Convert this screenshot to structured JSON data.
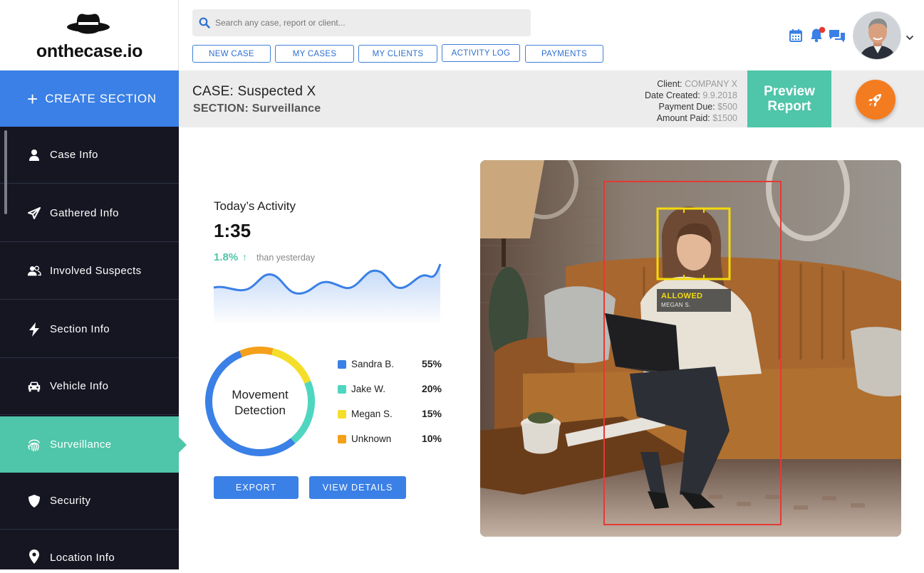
{
  "brand": {
    "name": "onthecase.io",
    "icon": "detective-hat-icon"
  },
  "search": {
    "placeholder": "Search any case, report or client..."
  },
  "nav_buttons": [
    "NEW CASE",
    "MY CASES",
    "MY CLIENTS",
    "ACTIVITY LOG",
    "PAYMENTS"
  ],
  "top_icons": [
    "calendar-icon",
    "bell-icon",
    "chat-icon"
  ],
  "notification_dot_color": "#e53935",
  "header": {
    "case": "CASE: Suspected X",
    "section": "SECTION: Surveillance",
    "meta": [
      {
        "label": "Client:",
        "value": "COMPANY X"
      },
      {
        "label": "Date Created:",
        "value": "9.9.2018"
      },
      {
        "label": "Payment Due:",
        "value": "$500"
      },
      {
        "label": "Amount Paid:",
        "value": "$1500"
      }
    ],
    "preview_line1": "Preview",
    "preview_line2": "Report",
    "rocket_icon": "rocket-icon"
  },
  "sidebar": {
    "create_label": "CREATE SECTION",
    "items": [
      {
        "label": "Case Info",
        "icon": "user-icon"
      },
      {
        "label": "Gathered Info",
        "icon": "paper-plane-icon"
      },
      {
        "label": "Involved Suspects",
        "icon": "users-icon"
      },
      {
        "label": "Section Info",
        "icon": "bolt-icon"
      },
      {
        "label": "Vehicle Info",
        "icon": "car-icon"
      },
      {
        "label": "Surveillance",
        "icon": "fingerprint-icon",
        "active": true
      },
      {
        "label": "Security",
        "icon": "shield-icon"
      },
      {
        "label": "Location Info",
        "icon": "map-pin-icon"
      }
    ]
  },
  "activity": {
    "title": "Today’s Activity",
    "time": "1:35",
    "change": "1.8%",
    "change_direction": "up",
    "comparison": "than yesterday"
  },
  "movement": {
    "label_line1": "Movement",
    "label_line2": "Detection",
    "legend": [
      {
        "name": "Sandra B.",
        "pct": "55%",
        "value": 55,
        "color": "#3a80e6"
      },
      {
        "name": "Jake W.",
        "pct": "20%",
        "value": 20,
        "color": "#4fd6c0"
      },
      {
        "name": "Megan S.",
        "pct": "15%",
        "value": 15,
        "color": "#f5de2a"
      },
      {
        "name": "Unknown",
        "pct": "10%",
        "value": 10,
        "color": "#f5a01a"
      }
    ]
  },
  "actions": {
    "export": "EXPORT",
    "details": "VIEW DETAILS"
  },
  "detection": {
    "status": "ALLOWED",
    "person": "MEGAN S.",
    "status_color": "#f5d90a",
    "body_box_color": "#e53935"
  },
  "colors": {
    "accent_blue": "#3a80e6",
    "accent_teal": "#4fc5a9",
    "sidebar_bg": "#161623",
    "rocket_orange": "#f47c20"
  }
}
